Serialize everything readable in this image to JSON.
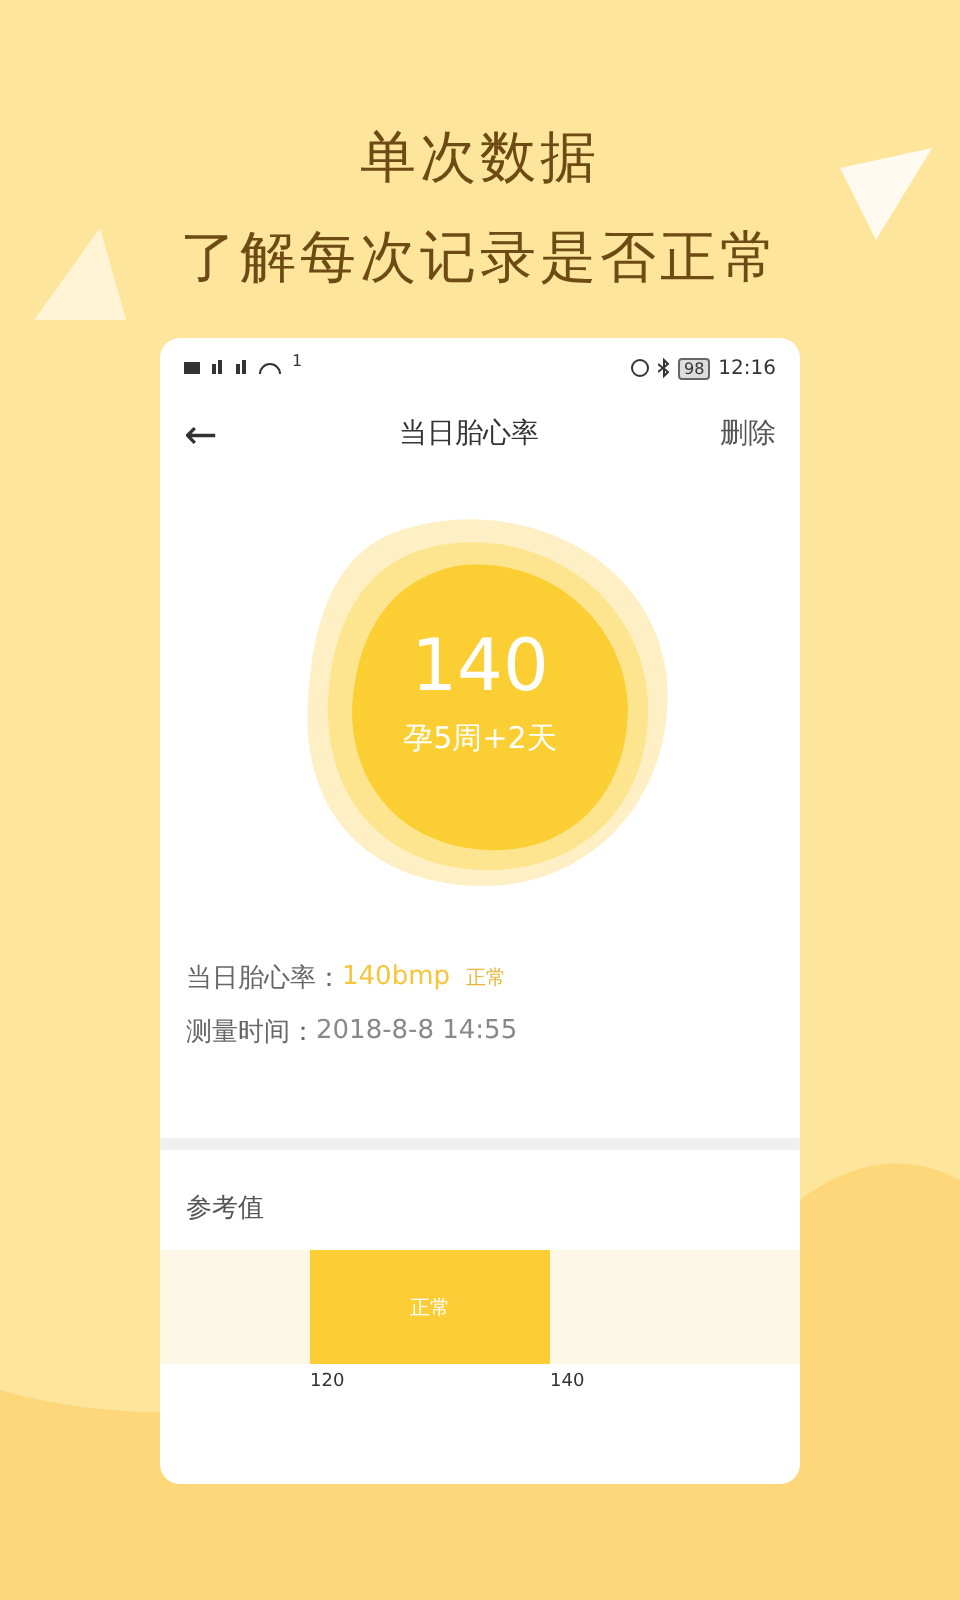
{
  "headline": [
    "单次数据",
    "了解每次记录是否正常"
  ],
  "status_bar": {
    "superscript": "1",
    "battery": "98",
    "time": "12:16"
  },
  "nav": {
    "back": "←",
    "title": "当日胎心率",
    "action": "删除"
  },
  "summary": {
    "value": "140",
    "week": "孕5周+2天"
  },
  "details": [
    {
      "label": "当日胎心率：",
      "value": "140bmp",
      "kind": "highlight",
      "tag": "正常"
    },
    {
      "label": "测量时间：",
      "value": "2018-8-8  14:55",
      "kind": "plain"
    }
  ],
  "reference": {
    "title": "参考值",
    "range_label": "正常",
    "low": "120",
    "high": "140"
  }
}
